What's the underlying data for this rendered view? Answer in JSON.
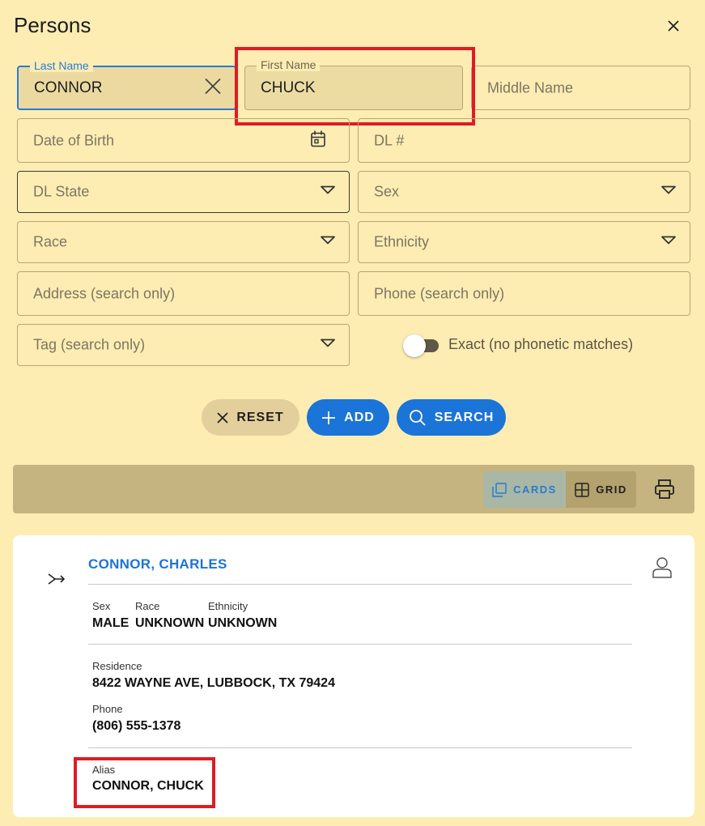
{
  "dialog": {
    "title": "Persons"
  },
  "form": {
    "last_name": {
      "label": "Last Name",
      "value": "CONNOR"
    },
    "first_name": {
      "label": "First Name",
      "value": "CHUCK"
    },
    "middle_name": {
      "placeholder": "Middle Name"
    },
    "dob": {
      "placeholder": "Date of Birth"
    },
    "dl_number": {
      "placeholder": "DL #"
    },
    "dl_state": {
      "placeholder": "DL State"
    },
    "sex": {
      "placeholder": "Sex"
    },
    "race": {
      "placeholder": "Race"
    },
    "ethnicity": {
      "placeholder": "Ethnicity"
    },
    "address": {
      "placeholder": "Address (search only)"
    },
    "phone": {
      "placeholder": "Phone (search only)"
    },
    "tag": {
      "placeholder": "Tag (search only)"
    },
    "exact_toggle": {
      "label": "Exact (no phonetic matches)",
      "on": false
    }
  },
  "actions": {
    "reset": "RESET",
    "add": "ADD",
    "search": "SEARCH"
  },
  "toolbar": {
    "cards": "CARDS",
    "grid": "GRID",
    "active_view": "cards"
  },
  "result": {
    "name": "CONNOR, CHARLES",
    "sex_label": "Sex",
    "sex": "MALE",
    "race_label": "Race",
    "race": "UNKNOWN",
    "ethnicity_label": "Ethnicity",
    "ethnicity": "UNKNOWN",
    "residence_label": "Residence",
    "residence": "8422 WAYNE AVE, LUBBOCK, TX 79424",
    "phone_label": "Phone",
    "phone": "(806) 555-1378",
    "alias_label": "Alias",
    "alias": "CONNOR, CHUCK"
  },
  "colors": {
    "background": "#fdedb3",
    "accent": "#1b74d8",
    "highlight": "#e01b24"
  }
}
